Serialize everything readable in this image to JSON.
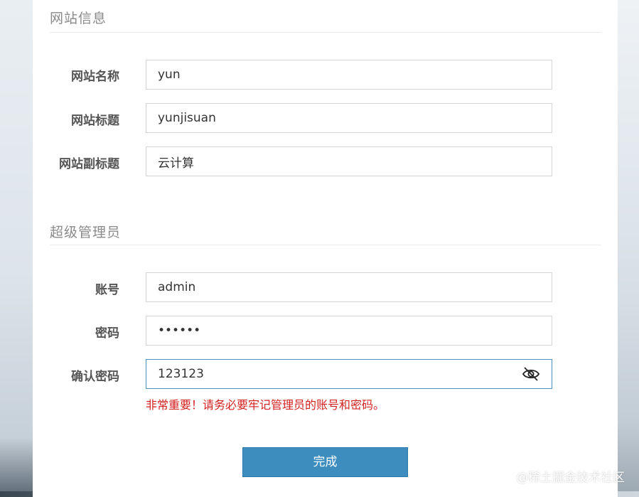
{
  "site_info": {
    "title": "网站信息",
    "fields": [
      {
        "label": "网站名称",
        "value": "yun"
      },
      {
        "label": "网站标题",
        "value": "yunjisuan"
      },
      {
        "label": "网站副标题",
        "value": "云计算"
      }
    ]
  },
  "admin": {
    "title": "超级管理员",
    "account": {
      "label": "账号",
      "value": "admin"
    },
    "password": {
      "label": "密码",
      "value": "••••••"
    },
    "confirm": {
      "label": "确认密码",
      "value": "123123"
    }
  },
  "warning": "非常重要！请务必要牢记管理员的账号和密码。",
  "submit_label": "完成",
  "watermark": "@稀土掘金技术社区",
  "icons": {
    "password_toggle": "eye-off-icon"
  },
  "colors": {
    "primary_button": "#3d8ebf",
    "warning_text": "#d42020",
    "active_border": "#4a90c0"
  }
}
